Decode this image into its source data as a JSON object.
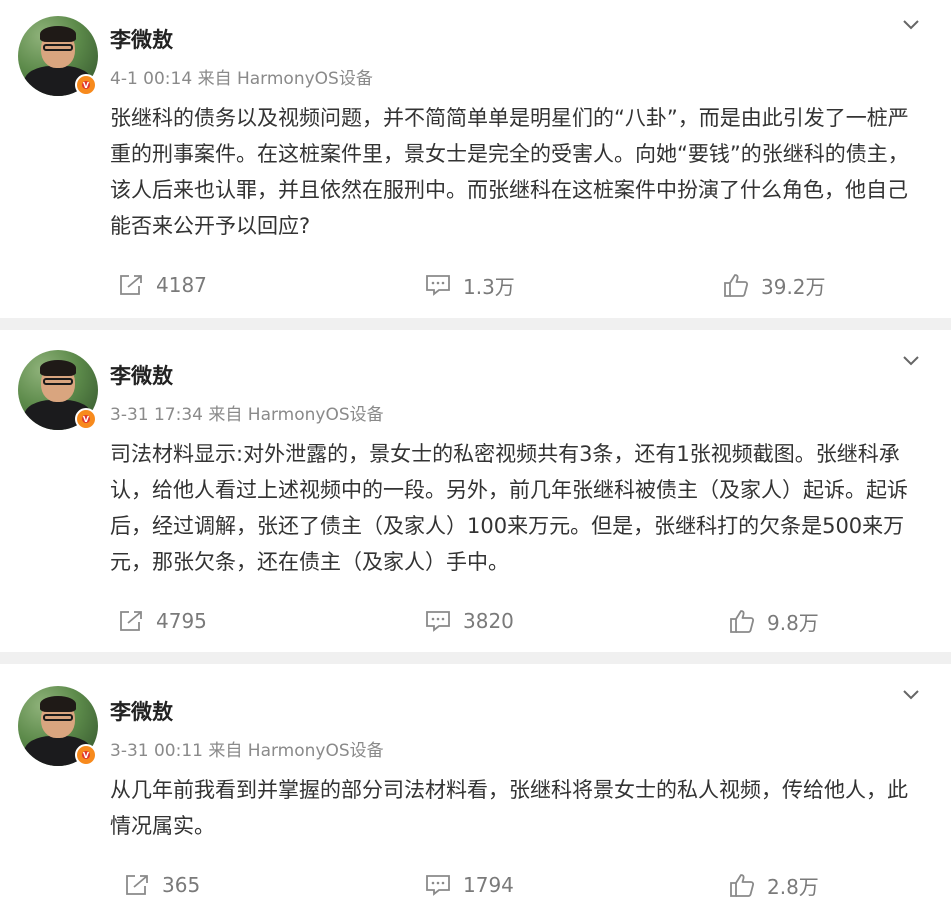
{
  "posts": [
    {
      "author": "李微敖",
      "meta": "4-1 00:14 来自 HarmonyOS设备",
      "content": "张继科的债务以及视频问题，并不简简单单是明星们的“八卦”，而是由此引发了一桩严重的刑事案件。在这桩案件里，景女士是完全的受害人。向她“要钱”的张继科的债主，该人后来也认罪，并且依然在服刑中。而张继科在这桩案件中扮演了什么角色，他自己能否来公开予以回应?",
      "reposts": "4187",
      "comments": "1.3万",
      "likes": "39.2万"
    },
    {
      "author": "李微敖",
      "meta": "3-31 17:34 来自 HarmonyOS设备",
      "content": "司法材料显示:对外泄露的，景女士的私密视频共有3条，还有1张视频截图。张继科承认，给他人看过上述视频中的一段。另外，前几年张继科被债主（及家人）起诉。起诉后，经过调解，张还了债主（及家人）100来万元。但是，张继科打的欠条是500来万元，那张欠条，还在债主（及家人）手中。",
      "reposts": "4795",
      "comments": "3820",
      "likes": "9.8万"
    },
    {
      "author": "李微敖",
      "meta": "3-31 00:11 来自 HarmonyOS设备",
      "content": "从几年前我看到并掌握的部分司法材料看，张继科将景女士的私人视频，传给他人，此情况属实。",
      "reposts": "365",
      "comments": "1794",
      "likes": "2.8万"
    }
  ],
  "icons": {
    "badge": "verified-badge-icon",
    "menu": "chevron-down-icon",
    "repost": "repost-icon",
    "comment": "comment-icon",
    "like": "thumbs-up-icon"
  },
  "colors": {
    "badge": "#f78a1d",
    "meta_text": "#8a8a8a",
    "action_text": "#7a7a7a",
    "separator": "#f0f0f0"
  }
}
